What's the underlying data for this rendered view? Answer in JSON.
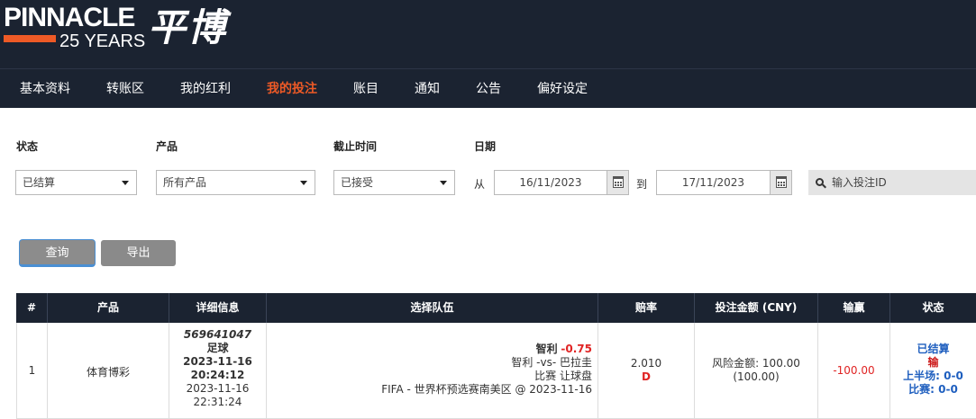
{
  "brand": {
    "name": "PINNACLE",
    "years": "25 YEARS",
    "cn_name": "平博"
  },
  "nav": {
    "items": [
      {
        "label": "基本资料"
      },
      {
        "label": "转账区"
      },
      {
        "label": "我的红利"
      },
      {
        "label": "我的投注",
        "active": true
      },
      {
        "label": "账目"
      },
      {
        "label": "通知"
      },
      {
        "label": "公告"
      },
      {
        "label": "偏好设定"
      }
    ]
  },
  "filters": {
    "status_label": "状态",
    "status_value": "已结算",
    "product_label": "产品",
    "product_value": "所有产品",
    "cutoff_label": "截止时间",
    "cutoff_value": "已接受",
    "date_label": "日期",
    "from_label": "从",
    "from_date": "16/11/2023",
    "to_label": "到",
    "to_date": "17/11/2023",
    "bet_id_placeholder": "输入投注ID"
  },
  "buttons": {
    "query": "查询",
    "export": "导出"
  },
  "table": {
    "headers": [
      "#",
      "产品",
      "详细信息",
      "选择队伍",
      "赔率",
      "投注金额 (CNY)",
      "输赢",
      "状态"
    ],
    "rows": [
      {
        "index": "1",
        "product": "体育博彩",
        "details": {
          "bet_id": "569641047",
          "sport": "足球",
          "placed_date": "2023-11-16",
          "placed_time": "20:24:12",
          "settled_date": "2023-11-16",
          "settled_time": "22:31:24"
        },
        "selection": {
          "team": "智利",
          "handicap": "-0.75",
          "matchup": "智利 -vs- 巴拉圭",
          "market": "比赛 让球盘",
          "league": "FIFA - 世界杯预选赛南美区 @ 2023-11-16"
        },
        "odds": {
          "value": "2.010",
          "format": "D"
        },
        "stake": {
          "risk": "风险金额: 100.00",
          "win": "(100.00)"
        },
        "win_loss": "-100.00",
        "status": {
          "state": "已结算",
          "result": "输",
          "first_half": "上半场: 0-0",
          "full_time": "比赛: 0-0"
        }
      }
    ]
  },
  "colors": {
    "header_bg": "#1b2331",
    "accent": "#ee5a26",
    "loss_red": "#e02424",
    "status_blue": "#1f5fbf"
  }
}
